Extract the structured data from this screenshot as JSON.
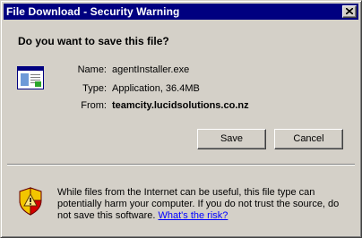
{
  "window": {
    "title": "File Download - Security Warning",
    "close_icon": "close-icon"
  },
  "prompt": {
    "question": "Do you want to save this file?"
  },
  "file": {
    "icon": "application-file-icon",
    "name_label": "Name:",
    "name_value": "agentInstaller.exe",
    "type_label": "Type:",
    "type_value": "Application, 36.4MB",
    "from_label": "From:",
    "from_value": "teamcity.lucidsolutions.co.nz"
  },
  "buttons": {
    "save_label": "Save",
    "cancel_label": "Cancel"
  },
  "warning": {
    "icon": "security-shield-icon",
    "text": "While files from the Internet can be useful, this file type can potentially harm your computer. If you do not trust the source, do not save this software. ",
    "link_text": "What's the risk?"
  },
  "colors": {
    "titlebar": "#000080",
    "dialog_bg": "#d4d0c8",
    "link": "#0000ff",
    "shield_yellow": "#f2c500",
    "shield_red": "#d40000"
  }
}
